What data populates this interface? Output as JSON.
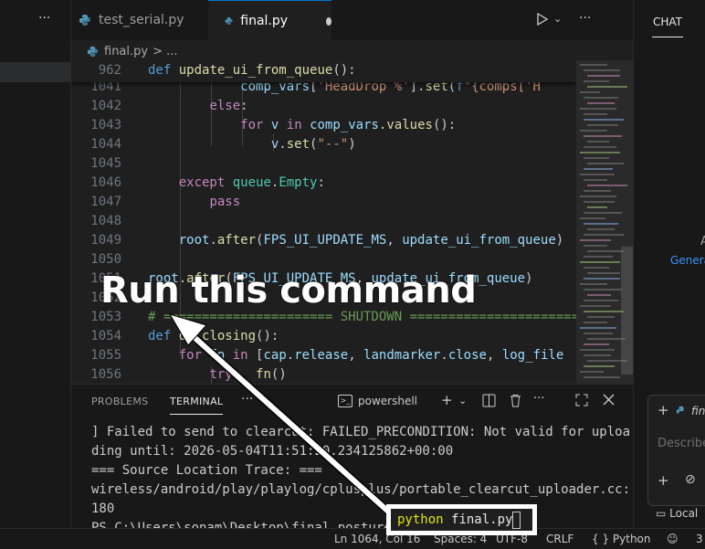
{
  "sidebar": {
    "more_label": "···"
  },
  "tabs": [
    {
      "label": "test_serial.py"
    },
    {
      "label": "final.py"
    }
  ],
  "breadcrumb": {
    "file": "final.py",
    "more": "> ..."
  },
  "editor": {
    "sticky_line": {
      "num": "962",
      "def": "def",
      "name": "update_ui_from_queue",
      "rest": "():"
    },
    "lines": [
      {
        "num": "1041"
      },
      {
        "num": "1042"
      },
      {
        "num": "1043"
      },
      {
        "num": "1044"
      },
      {
        "num": "1045"
      },
      {
        "num": "1046"
      },
      {
        "num": "1047"
      },
      {
        "num": "1048"
      },
      {
        "num": "1049"
      },
      {
        "num": "1050"
      },
      {
        "num": "1051"
      },
      {
        "num": "1052"
      },
      {
        "num": "1053"
      },
      {
        "num": "1054"
      },
      {
        "num": "1055"
      },
      {
        "num": "1056"
      }
    ]
  },
  "chat": {
    "title": "CHAT",
    "letter": "A",
    "link": "Genera",
    "input_file": "fina",
    "placeholder": "Describe",
    "local": "Local"
  },
  "panel": {
    "tabs": [
      "PROBLEMS",
      "TERMINAL"
    ],
    "more": "···",
    "shell": "powershell",
    "terminal_lines": [
      "] Failed to send to clearcut: FAILED_PRECONDITION: Not valid for uploa",
      "ding until: 2026-05-04T11:51:20.234125862+00:00",
      "=== Source Location Trace: ===",
      "wireless/android/play/playlog/cplusplus/portable_clearcut_uploader.cc:",
      "180",
      "PS C:\\Users\\sonam\\Desktop\\final_posture>"
    ]
  },
  "status": {
    "position": "Ln 1064, Col 16",
    "spaces": "Spaces: 4",
    "encoding": "UTF-8",
    "eol": "CRLF",
    "language": "{ } Python",
    "extra": "3"
  },
  "annotation": {
    "text": "Run this command",
    "command_py": "python",
    "command_file": "final.py"
  },
  "colors": {
    "accent": "#0078d4",
    "keyword": "#c586c0",
    "function": "#dcdcaa"
  }
}
